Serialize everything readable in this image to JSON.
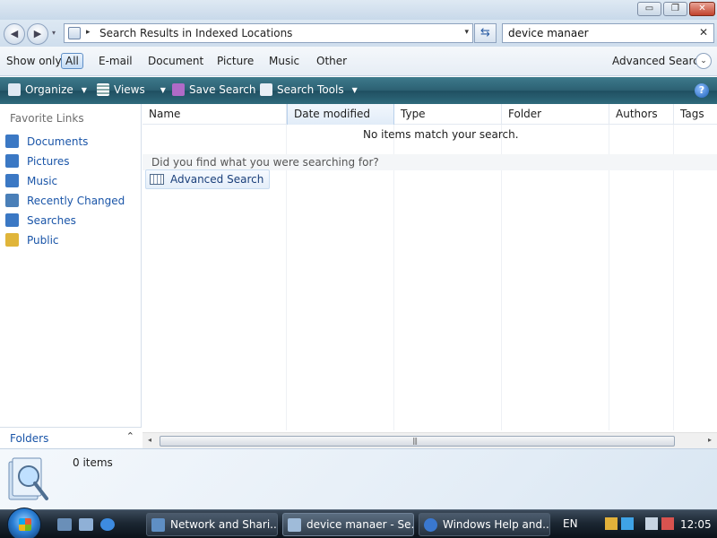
{
  "window": {
    "controls": {
      "minimize": "▭",
      "restore": "❐",
      "close": "✕"
    }
  },
  "address_bar": {
    "path": "Search Results in Indexed Locations",
    "separator": "▸",
    "dropdown": "▾",
    "refresh": "⇆"
  },
  "search": {
    "value": "device manaer",
    "clear": "✕"
  },
  "filter_bar": {
    "label": "Show only:",
    "options": [
      "All",
      "E-mail",
      "Document",
      "Picture",
      "Music",
      "Other"
    ],
    "active": "All",
    "advanced_search": "Advanced Search",
    "advanced_chevron": "⌄"
  },
  "toolbar": {
    "organize": "Organize",
    "views": "Views",
    "save_search": "Save Search",
    "search_tools": "Search Tools",
    "help": "?"
  },
  "sidebar": {
    "title": "Favorite Links",
    "items": [
      {
        "label": "Documents",
        "icon": "documents-icon",
        "color": "#3b78c4"
      },
      {
        "label": "Pictures",
        "icon": "pictures-icon",
        "color": "#3b78c4"
      },
      {
        "label": "Music",
        "icon": "music-icon",
        "color": "#3b78c4"
      },
      {
        "label": "Recently Changed",
        "icon": "recently-changed-icon",
        "color": "#4a7fb8"
      },
      {
        "label": "Searches",
        "icon": "searches-icon",
        "color": "#3b78c4"
      },
      {
        "label": "Public",
        "icon": "public-folder-icon",
        "color": "#e0b53a"
      }
    ],
    "folders_label": "Folders",
    "folders_chevron": "⌃"
  },
  "content": {
    "columns": [
      "Name",
      "Date modified",
      "Type",
      "Folder",
      "Authors",
      "Tags"
    ],
    "empty_message": "No items match your search.",
    "prompt": "Did you find what you were searching for?",
    "advanced_search_button": "Advanced Search"
  },
  "scrollbar": {
    "left": "◂",
    "right": "▸",
    "grip": "|||"
  },
  "details_pane": {
    "item_count": "0 items"
  },
  "taskbar": {
    "buttons": [
      {
        "label": "Network and Shari...",
        "icon": "network-icon"
      },
      {
        "label": "device manaer - Se...",
        "icon": "search-folder-icon"
      },
      {
        "label": "Windows Help and...",
        "icon": "help-icon"
      }
    ],
    "language": "EN",
    "clock": "12:05"
  },
  "colors": {
    "link": "#1a55a8",
    "toolbar": "#2c6072",
    "taskbar": "#1c2733"
  }
}
